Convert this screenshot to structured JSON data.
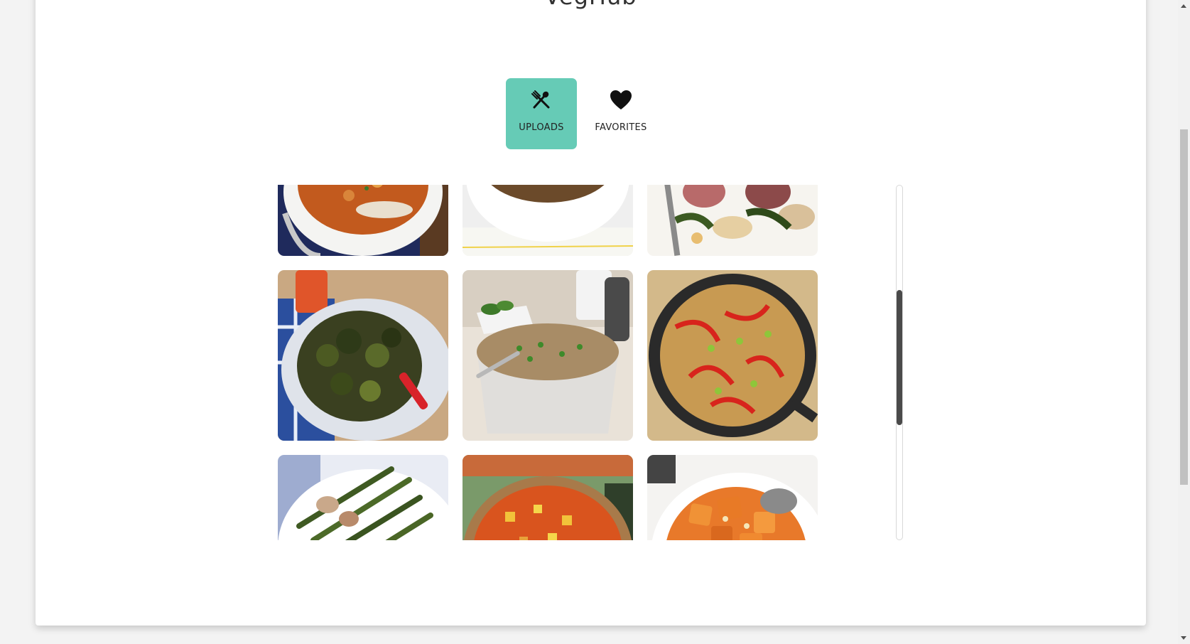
{
  "header": {
    "title": "VegHub"
  },
  "tabs": [
    {
      "label": "UPLOADS",
      "icon": "utensils-icon",
      "active": true
    },
    {
      "label": "FAVORITES",
      "icon": "heart-icon",
      "active": false
    }
  ],
  "colors": {
    "accent": "#66cbb6",
    "page_background": "#f3f3f3",
    "card_background": "#ffffff",
    "scroll_thumb": "#4a4a4a"
  },
  "gallery": {
    "photos": [
      {
        "subject": "chickpea curry with rice in white bowl"
      },
      {
        "subject": "noodles with greens in white bowl"
      },
      {
        "subject": "roasted red potatoes with peppers"
      },
      {
        "subject": "roasted broccoli in white bowl"
      },
      {
        "subject": "rice with peas in glass bowl"
      },
      {
        "subject": "stir-fried noodles with red peppers in skillet"
      },
      {
        "subject": "roasted asparagus with potatoes"
      },
      {
        "subject": "vegetable stew in wooden bowl"
      },
      {
        "subject": "glazed sweet potatoes in white bowl"
      }
    ],
    "scroll_position": 0.3
  }
}
